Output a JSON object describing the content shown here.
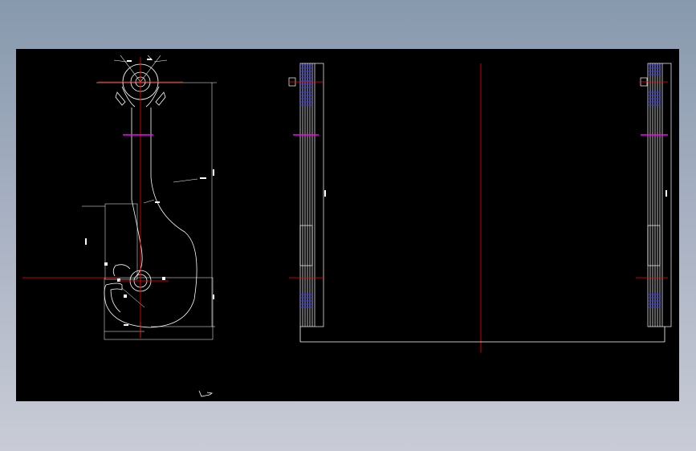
{
  "app": {
    "background_gradient": [
      "#8799ad",
      "#c9ccd6"
    ],
    "canvas_color": "#000000"
  },
  "colors": {
    "outline": "#ffffff",
    "centerline": "#ff0000",
    "highlight": "#ff00ff",
    "hatch": "#3333ff",
    "dimension": "#ffffff"
  },
  "drawing": {
    "views": [
      {
        "name": "hook-front-view"
      },
      {
        "name": "left-side-view"
      },
      {
        "name": "right-side-view"
      }
    ],
    "icons": [
      "ucs-icon"
    ]
  }
}
